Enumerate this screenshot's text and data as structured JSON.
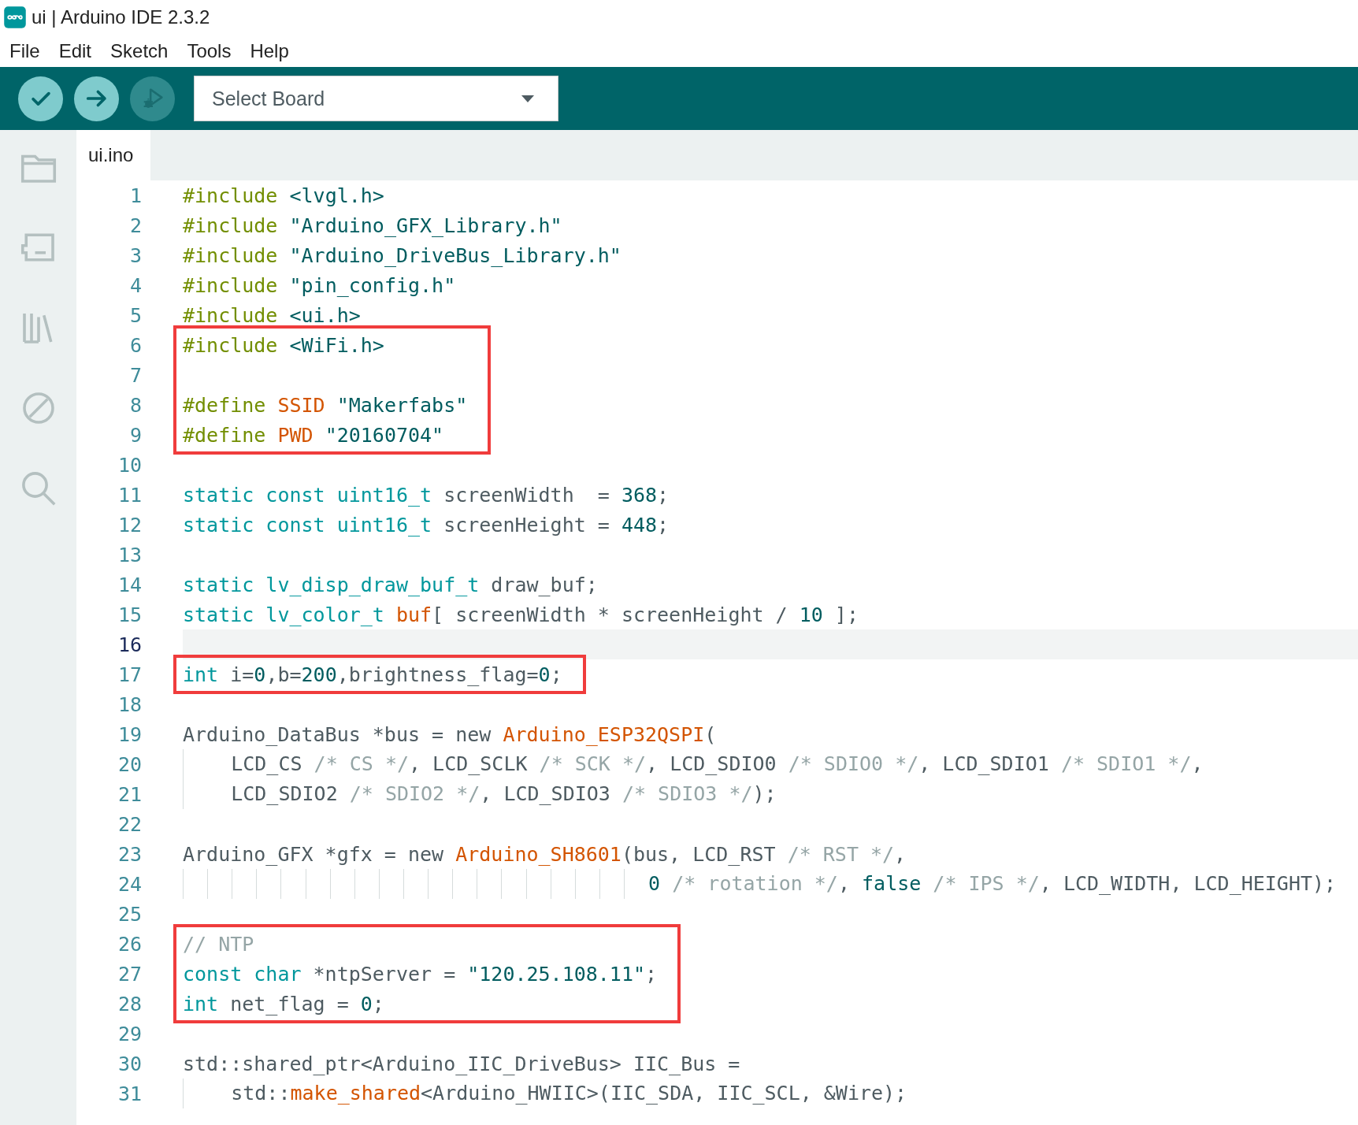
{
  "window": {
    "title": "ui | Arduino IDE 2.3.2"
  },
  "menu": [
    "File",
    "Edit",
    "Sketch",
    "Tools",
    "Help"
  ],
  "toolbar": {
    "buttons": [
      {
        "kind": "verify",
        "disabled": false
      },
      {
        "kind": "upload",
        "disabled": false
      },
      {
        "kind": "debug",
        "disabled": true
      }
    ],
    "board_select": {
      "value": "Select Board"
    }
  },
  "sidebar": {
    "items": [
      {
        "kind": "folder"
      },
      {
        "kind": "board"
      },
      {
        "kind": "library"
      },
      {
        "kind": "debug"
      },
      {
        "kind": "search"
      }
    ]
  },
  "tabs": [
    {
      "label": "ui.ino",
      "selected": true
    }
  ],
  "editor": {
    "lines": [
      {
        "number": "1",
        "tokens": [
          {
            "kind": "pp",
            "text": "#include"
          },
          {
            "kind": "str",
            "text": " <lvgl.h>"
          }
        ]
      },
      {
        "number": "2",
        "tokens": [
          {
            "kind": "pp",
            "text": "#include"
          },
          {
            "kind": "str",
            "text": " \"Arduino_GFX_Library.h\""
          }
        ]
      },
      {
        "number": "3",
        "tokens": [
          {
            "kind": "pp",
            "text": "#include"
          },
          {
            "kind": "str",
            "text": " \"Arduino_DriveBus_Library.h\""
          }
        ]
      },
      {
        "number": "4",
        "tokens": [
          {
            "kind": "pp",
            "text": "#include"
          },
          {
            "kind": "str",
            "text": " \"pin_config.h\""
          }
        ]
      },
      {
        "number": "5",
        "tokens": [
          {
            "kind": "pp",
            "text": "#include"
          },
          {
            "kind": "str",
            "text": " <ui.h>"
          }
        ]
      },
      {
        "number": "6",
        "boxed": true,
        "tokens": [
          {
            "kind": "pp",
            "text": "#include"
          },
          {
            "kind": "str",
            "text": " <WiFi.h>"
          }
        ]
      },
      {
        "number": "7",
        "boxed": true
      },
      {
        "number": "8",
        "boxed": true,
        "tokens": [
          {
            "kind": "pp",
            "text": "#define"
          },
          {
            "kind": "fn",
            "text": " SSID"
          },
          {
            "kind": "str",
            "text": " \"Makerfabs\""
          }
        ]
      },
      {
        "number": "9",
        "boxed": true,
        "tokens": [
          {
            "kind": "pp",
            "text": "#define"
          },
          {
            "kind": "fn",
            "text": " PWD"
          },
          {
            "kind": "str",
            "text": " \"20160704\""
          }
        ]
      },
      {
        "number": "10"
      },
      {
        "number": "11",
        "tokens": [
          {
            "kind": "kw",
            "text": "static const uint16_t"
          },
          {
            "kind": "tx",
            "text": " screenWidth  = "
          },
          {
            "kind": "num",
            "text": "368"
          },
          {
            "kind": "tx",
            "text": ";"
          }
        ]
      },
      {
        "number": "12",
        "tokens": [
          {
            "kind": "kw",
            "text": "static const uint16_t"
          },
          {
            "kind": "tx",
            "text": " screenHeight = "
          },
          {
            "kind": "num",
            "text": "448"
          },
          {
            "kind": "tx",
            "text": ";"
          }
        ]
      },
      {
        "number": "13"
      },
      {
        "number": "14",
        "tokens": [
          {
            "kind": "kw",
            "text": "static lv_disp_draw_buf_t"
          },
          {
            "kind": "tx",
            "text": " draw_buf;"
          }
        ]
      },
      {
        "number": "15",
        "tokens": [
          {
            "kind": "kw",
            "text": "static lv_color_t"
          },
          {
            "kind": "fn",
            "text": " buf"
          },
          {
            "kind": "tx",
            "text": "[ screenWidth * screenHeight / "
          },
          {
            "kind": "num",
            "text": "10"
          },
          {
            "kind": "tx",
            "text": " ];"
          }
        ]
      },
      {
        "number": "16",
        "current": true
      },
      {
        "number": "17",
        "boxed": true,
        "tokens": [
          {
            "kind": "kw",
            "text": "int"
          },
          {
            "kind": "tx",
            "text": " i="
          },
          {
            "kind": "num",
            "text": "0"
          },
          {
            "kind": "tx",
            "text": ",b="
          },
          {
            "kind": "num",
            "text": "200"
          },
          {
            "kind": "tx",
            "text": ",brightness_flag="
          },
          {
            "kind": "num",
            "text": "0"
          },
          {
            "kind": "tx",
            "text": ";"
          }
        ]
      },
      {
        "number": "18"
      },
      {
        "number": "19",
        "tokens": [
          {
            "kind": "tx",
            "text": "Arduino_DataBus *bus = new "
          },
          {
            "kind": "fn",
            "text": "Arduino_ESP32QSPI"
          },
          {
            "kind": "tx",
            "text": "("
          }
        ]
      },
      {
        "number": "20",
        "tokens": [
          {
            "kind": "tx",
            "text": "    LCD_CS "
          },
          {
            "kind": "cm",
            "text": "/* CS */"
          },
          {
            "kind": "tx",
            "text": ", LCD_SCLK "
          },
          {
            "kind": "cm",
            "text": "/* SCK */"
          },
          {
            "kind": "tx",
            "text": ", LCD_SDIO0 "
          },
          {
            "kind": "cm",
            "text": "/* SDIO0 */"
          },
          {
            "kind": "tx",
            "text": ", LCD_SDIO1 "
          },
          {
            "kind": "cm",
            "text": "/* SDIO1 */"
          },
          {
            "kind": "tx",
            "text": ","
          }
        ]
      },
      {
        "number": "21",
        "tokens": [
          {
            "kind": "tx",
            "text": "    LCD_SDIO2 "
          },
          {
            "kind": "cm",
            "text": "/* SDIO2 */"
          },
          {
            "kind": "tx",
            "text": ", LCD_SDIO3 "
          },
          {
            "kind": "cm",
            "text": "/* SDIO3 */"
          },
          {
            "kind": "tx",
            "text": ");"
          }
        ]
      },
      {
        "number": "22"
      },
      {
        "number": "23",
        "tokens": [
          {
            "kind": "tx",
            "text": "Arduino_GFX *gfx = new "
          },
          {
            "kind": "fn",
            "text": "Arduino_SH8601"
          },
          {
            "kind": "tx",
            "text": "(bus, LCD_RST "
          },
          {
            "kind": "cm",
            "text": "/* RST */"
          },
          {
            "kind": "tx",
            "text": ","
          }
        ]
      },
      {
        "number": "24",
        "tokens": [
          {
            "kind": "num",
            "text": "                                      0"
          },
          {
            "kind": "cm",
            "text": " /* rotation */"
          },
          {
            "kind": "tx",
            "text": ", "
          },
          {
            "kind": "num",
            "text": "false"
          },
          {
            "kind": "cm",
            "text": " /* IPS */"
          },
          {
            "kind": "tx",
            "text": ", LCD_WIDTH, LCD_HEIGHT);"
          }
        ]
      },
      {
        "number": "25"
      },
      {
        "number": "26",
        "boxed": true,
        "tokens": [
          {
            "kind": "cm",
            "text": "// NTP"
          }
        ]
      },
      {
        "number": "27",
        "boxed": true,
        "tokens": [
          {
            "kind": "kw",
            "text": "const char"
          },
          {
            "kind": "tx",
            "text": " *ntpServer = "
          },
          {
            "kind": "str",
            "text": "\"120.25.108.11\""
          },
          {
            "kind": "tx",
            "text": ";"
          }
        ]
      },
      {
        "number": "28",
        "boxed": true,
        "tokens": [
          {
            "kind": "kw",
            "text": "int"
          },
          {
            "kind": "tx",
            "text": " net_flag = "
          },
          {
            "kind": "num",
            "text": "0"
          },
          {
            "kind": "tx",
            "text": ";"
          }
        ]
      },
      {
        "number": "29"
      },
      {
        "number": "30",
        "tokens": [
          {
            "kind": "tx",
            "text": "std::shared_ptr<Arduino_IIC_DriveBus> IIC_Bus ="
          }
        ]
      },
      {
        "number": "31",
        "tokens": [
          {
            "kind": "tx",
            "text": "    std::"
          },
          {
            "kind": "fn",
            "text": "make_shared"
          },
          {
            "kind": "tx",
            "text": "<Arduino_HWIIC>(IIC_SDA, IIC_SCL, &Wire);"
          }
        ]
      }
    ]
  }
}
